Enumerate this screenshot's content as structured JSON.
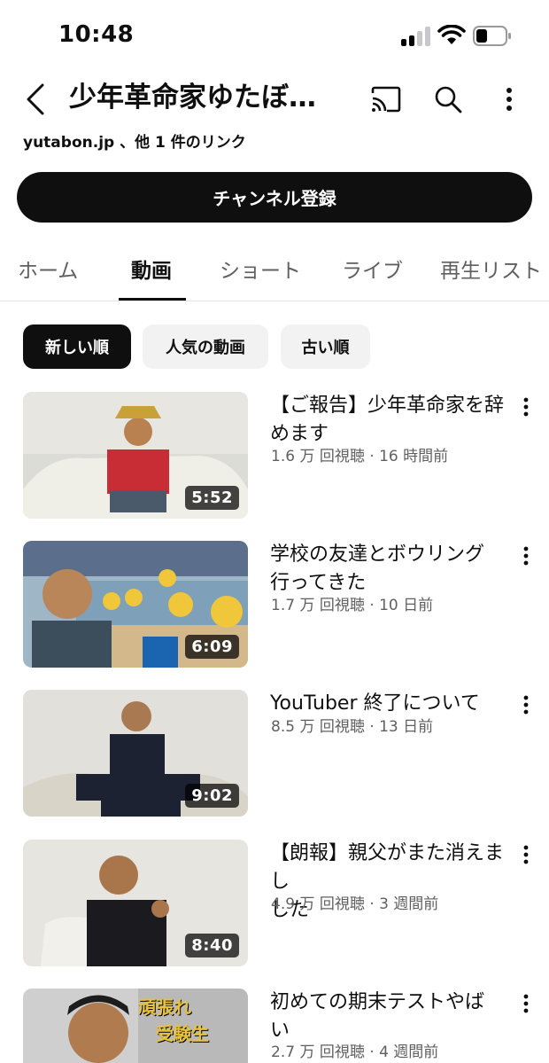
{
  "status_bar": {
    "time": "10:48",
    "icons": [
      "cellular-signal-icon",
      "wifi-icon",
      "battery-icon"
    ]
  },
  "header": {
    "channel_title": "少年革命家ゆたぼ…",
    "icons": [
      "back-arrow-icon",
      "cast-icon",
      "search-icon",
      "more-vert-icon"
    ]
  },
  "links_line": "yutabon.jp 、他 1 件のリンク",
  "subscribe_label": "チャンネル登録",
  "tabs": [
    {
      "label": "ホーム",
      "active": false
    },
    {
      "label": "動画",
      "active": true
    },
    {
      "label": "ショート",
      "active": false
    },
    {
      "label": "ライブ",
      "active": false
    },
    {
      "label": "再生リスト",
      "active": false
    }
  ],
  "chips": [
    {
      "label": "新しい順",
      "selected": true
    },
    {
      "label": "人気の動画",
      "selected": false
    },
    {
      "label": "古い順",
      "selected": false
    }
  ],
  "videos": [
    {
      "title_line1": "【ご報告】少年革命家を辞",
      "title_line2": "めます",
      "views": "1.6 万 回視聴",
      "age": "16 時間前",
      "duration": "5:52"
    },
    {
      "title_line1": "学校の友達とボウリング",
      "title_line2": "行ってきた",
      "views": "1.7 万 回視聴",
      "age": "10 日前",
      "duration": "6:09"
    },
    {
      "title_line1": "YouTuber 終了について",
      "title_line2": "",
      "views": "8.5 万 回視聴",
      "age": "13 日前",
      "duration": "9:02"
    },
    {
      "title_line1": "【朗報】親父がまた消えまし",
      "title_line2": "した",
      "views": "4.9 万 回視聴",
      "age": "3 週間前",
      "duration": "8:40"
    },
    {
      "title_line1": "初めての期末テストやば",
      "title_line2": "い",
      "views": "2.7 万 回視聴",
      "age": "4 週間前",
      "duration": ""
    }
  ],
  "thumb5_overlay": {
    "line1": "頑張れ",
    "line2": "受験生"
  },
  "meta_separator": " · ",
  "colors": {
    "primary_text": "#0f0f0f",
    "secondary_text": "#606060",
    "chip_bg": "#f2f2f2",
    "subscribe_bg": "#0f0f0f"
  }
}
